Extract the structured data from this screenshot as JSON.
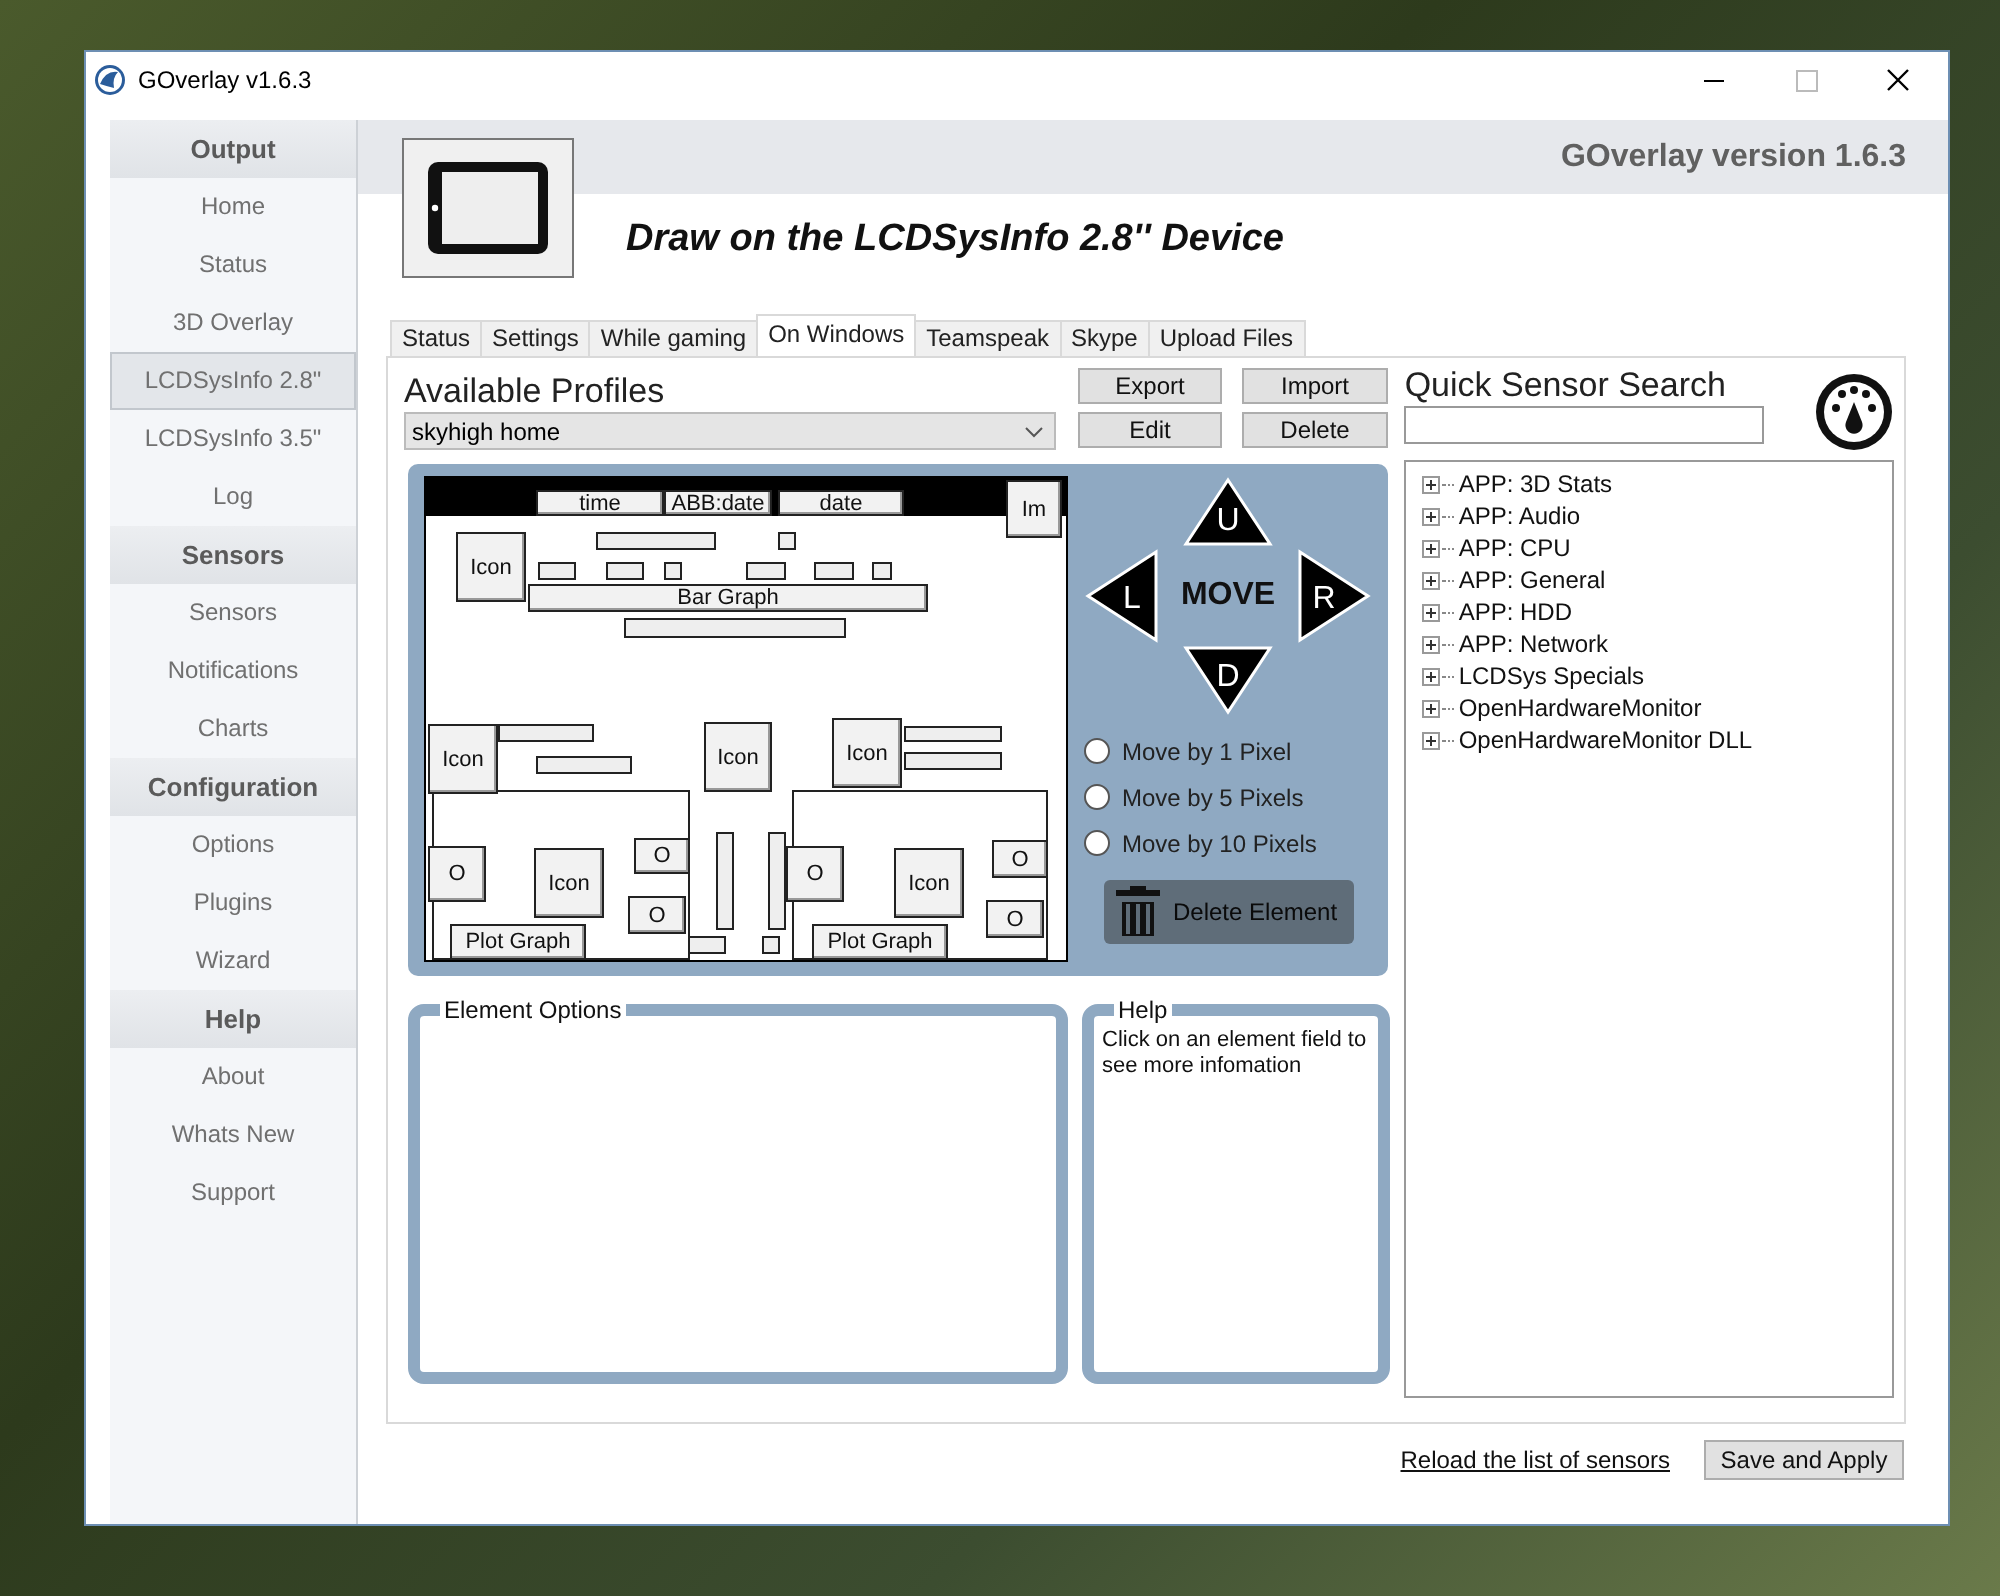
{
  "window": {
    "title": "GOverlay v1.6.3"
  },
  "sidebar": {
    "sections": [
      {
        "title": "Output",
        "items": [
          {
            "label": "Home",
            "selected": false
          },
          {
            "label": "Status",
            "selected": false
          },
          {
            "label": "3D Overlay",
            "selected": false
          },
          {
            "label": "LCDSysInfo 2.8\"",
            "selected": true
          },
          {
            "label": "LCDSysInfo 3.5\"",
            "selected": false
          },
          {
            "label": "Log",
            "selected": false
          }
        ]
      },
      {
        "title": "Sensors",
        "items": [
          {
            "label": "Sensors",
            "selected": false
          },
          {
            "label": "Notifications",
            "selected": false
          },
          {
            "label": "Charts",
            "selected": false
          }
        ]
      },
      {
        "title": "Configuration",
        "items": [
          {
            "label": "Options",
            "selected": false
          },
          {
            "label": "Plugins",
            "selected": false
          },
          {
            "label": "Wizard",
            "selected": false
          }
        ]
      },
      {
        "title": "Help",
        "items": [
          {
            "label": "About",
            "selected": false
          },
          {
            "label": "Whats New",
            "selected": false
          },
          {
            "label": "Support",
            "selected": false
          }
        ]
      }
    ]
  },
  "header": {
    "version": "GOverlay version 1.6.3",
    "page_title": "Draw on the LCDSysInfo 2.8'' Device"
  },
  "tabs": [
    {
      "label": "Status",
      "selected": false
    },
    {
      "label": "Settings",
      "selected": false
    },
    {
      "label": "While gaming",
      "selected": false
    },
    {
      "label": "On Windows",
      "selected": true
    },
    {
      "label": "Teamspeak",
      "selected": false
    },
    {
      "label": "Skype",
      "selected": false
    },
    {
      "label": "Upload Files",
      "selected": false
    }
  ],
  "profiles": {
    "title": "Available Profiles",
    "value": "skyhigh home",
    "buttons": [
      "Export",
      "Import",
      "Edit",
      "Delete"
    ]
  },
  "lcd_canvas": {
    "elements": [
      {
        "text": "time"
      },
      {
        "text": "ABB:date"
      },
      {
        "text": "date"
      },
      {
        "text": "Im"
      },
      {
        "text": "Icon"
      },
      {
        "text": "Bar Graph"
      },
      {
        "text": "Icon"
      },
      {
        "text": "Icon"
      },
      {
        "text": "Icon"
      },
      {
        "text": "O"
      },
      {
        "text": "Icon"
      },
      {
        "text": "O"
      },
      {
        "text": "O"
      },
      {
        "text": "Plot Graph"
      },
      {
        "text": "O"
      },
      {
        "text": "Icon"
      },
      {
        "text": "O"
      },
      {
        "text": "O"
      },
      {
        "text": "Plot Graph"
      }
    ]
  },
  "move": {
    "label": "MOVE",
    "arrows": [
      {
        "kind": "up",
        "label": "U"
      },
      {
        "kind": "left",
        "label": "L"
      },
      {
        "kind": "right",
        "label": "R"
      },
      {
        "kind": "down",
        "label": "D"
      }
    ],
    "steps": [
      {
        "label": "Move by 1 Pixel",
        "selected": false
      },
      {
        "label": "Move by 5 Pixels",
        "selected": false
      },
      {
        "label": "Move by 10 Pixels",
        "selected": false
      }
    ],
    "delete_button": "Delete Element"
  },
  "element_options": {
    "title": "Element Options"
  },
  "help": {
    "title": "Help",
    "text": "Click on an element field to see more infomation"
  },
  "sensor_search": {
    "title": "Quick Sensor Search"
  },
  "sensor_tree": [
    {
      "label": "APP: 3D Stats",
      "expanded": false
    },
    {
      "label": "APP: Audio",
      "expanded": false
    },
    {
      "label": "APP: CPU",
      "expanded": false
    },
    {
      "label": "APP: General",
      "expanded": false
    },
    {
      "label": "APP: HDD",
      "expanded": false
    },
    {
      "label": "APP: Network",
      "expanded": false
    },
    {
      "label": "LCDSys Specials",
      "expanded": false
    },
    {
      "label": "OpenHardwareMonitor",
      "expanded": false
    },
    {
      "label": "OpenHardwareMonitor DLL",
      "expanded": false
    }
  ],
  "footer": {
    "link": "Reload the list of sensors",
    "button": "Save and Apply"
  }
}
